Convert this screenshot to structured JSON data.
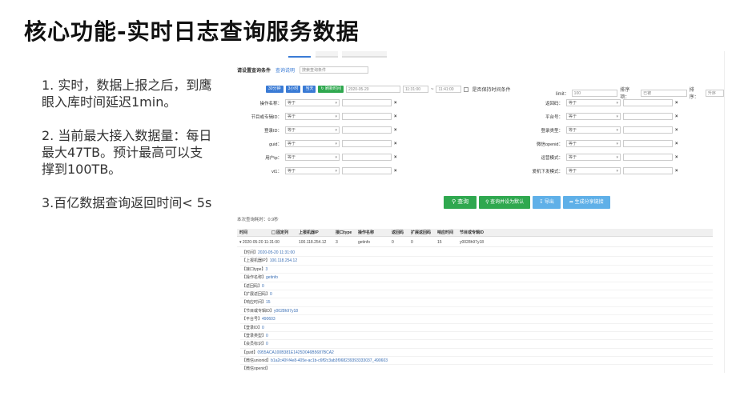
{
  "slide": {
    "title": "核心功能-实时日志查询服务数据",
    "bullets": [
      "1. 实时，数据上报之后，到鹰眼入库时间延迟1min。",
      "2. 当前最大接入数据量：每日最大47TB。预计最高可以支撑到100TB。",
      "3.百亿数据查询返回时间< 5s"
    ]
  },
  "screenshot": {
    "condition_title": "请设置查询条件",
    "condition_link": "查询说明",
    "condition_placeholder": "搜索查询条件",
    "time_buttons": [
      "30分钟",
      "3小时",
      "当天"
    ],
    "refresh_button": "刷新时间",
    "date": "2020-05-20",
    "time_start": "11:31:00",
    "time_sep": "~",
    "time_end": "11:41:00",
    "keep_time_label": "是否保持时间条件",
    "limit_label": "limit：",
    "limit_value": "100",
    "sort_field_label": "排序项：",
    "sort_field_value": "已被",
    "sort_order_label": "排序：",
    "sort_order_value": "升序",
    "op_default": "等于",
    "left_fields": [
      "操作名称：",
      "节目或专辑ID：",
      "登录ID：",
      "guid：",
      "用户ip：",
      "vt1："
    ],
    "right_fields": [
      "返回码：",
      "平台号：",
      "登录类型：",
      "微信openid：",
      "运营模式：",
      "爱机下发模式："
    ],
    "actions": {
      "query": "查询",
      "set_default": "查询并设为默认",
      "export": "导出",
      "share": "生成分享链接"
    },
    "elapsed": "本次查询耗时：0.9秒",
    "table": {
      "columns": [
        "时间",
        "固定列",
        "上报机器IP",
        "接口type",
        "操作名称",
        "返回码",
        "扩展返回码",
        "响应时间",
        "节目或专辑ID"
      ],
      "row": [
        "2020-05-20 11:31:00",
        "",
        "100.118.254.12",
        "3",
        "getinfo",
        "0",
        "0",
        "15",
        "y0028h97y18"
      ]
    },
    "details": [
      {
        "k": "【时间】",
        "v": "2020-05-20 11:31:00"
      },
      {
        "k": "【上报机器IP】",
        "v": "100.118.254.12"
      },
      {
        "k": "【接口type】",
        "v": "3"
      },
      {
        "k": "【操作名称】",
        "v": "getinfo"
      },
      {
        "k": "【返回码】",
        "v": "0"
      },
      {
        "k": "【扩展返回码】",
        "v": "0"
      },
      {
        "k": "【响应时间】",
        "v": "15"
      },
      {
        "k": "【节目或专辑ID】",
        "v": "y0028h97y18"
      },
      {
        "k": "【平台号】",
        "v": "490603"
      },
      {
        "k": "【登录ID】",
        "v": "0"
      },
      {
        "k": "【登录类型】",
        "v": "0"
      },
      {
        "k": "【会员标识】",
        "v": "0"
      },
      {
        "k": "【guid】",
        "v": "0955ACA100B381E1425D046B5687BCA2"
      },
      {
        "k": "【微信unionid】",
        "v": "b1a2c40f-f4e8-405e-ac1b-c6ff2c3ab3f068239393333037_490603"
      },
      {
        "k": "【微信openid】",
        "v": ""
      }
    ]
  }
}
